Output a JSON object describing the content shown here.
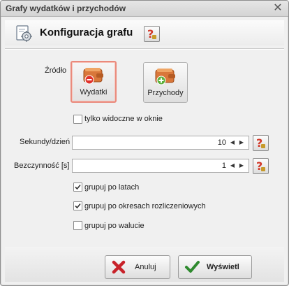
{
  "window": {
    "title": "Grafy wydatków i przychodów",
    "close_glyph": "✕"
  },
  "header": {
    "title": "Konfiguracja grafu",
    "icon": "gear-document-icon"
  },
  "source": {
    "label": "Źródło",
    "buttons": [
      {
        "label": "Wydatki",
        "icon": "wallet-minus-icon",
        "selected": true
      },
      {
        "label": "Przychody",
        "icon": "wallet-plus-icon",
        "selected": false
      }
    ],
    "only_visible": {
      "label": "tylko widoczne w oknie",
      "checked": false
    }
  },
  "seconds_per_day": {
    "label": "Sekundy/dzień",
    "value": "10"
  },
  "idle": {
    "label": "Bezczynność [s]",
    "value": "1"
  },
  "options": [
    {
      "label": "grupuj po latach",
      "checked": true
    },
    {
      "label": "grupuj po okresach rozliczeniowych",
      "checked": true
    },
    {
      "label": "grupuj po walucie",
      "checked": false
    }
  ],
  "footer": {
    "cancel_label": "Anuluj",
    "ok_label": "Wyświetl"
  },
  "colors": {
    "selected_border": "#ea8a7c",
    "wallet": "#d9773a",
    "minus": "#e0322b",
    "plus": "#5cb03a",
    "check_green": "#2f8a2f",
    "cancel_red": "#c8222a"
  }
}
